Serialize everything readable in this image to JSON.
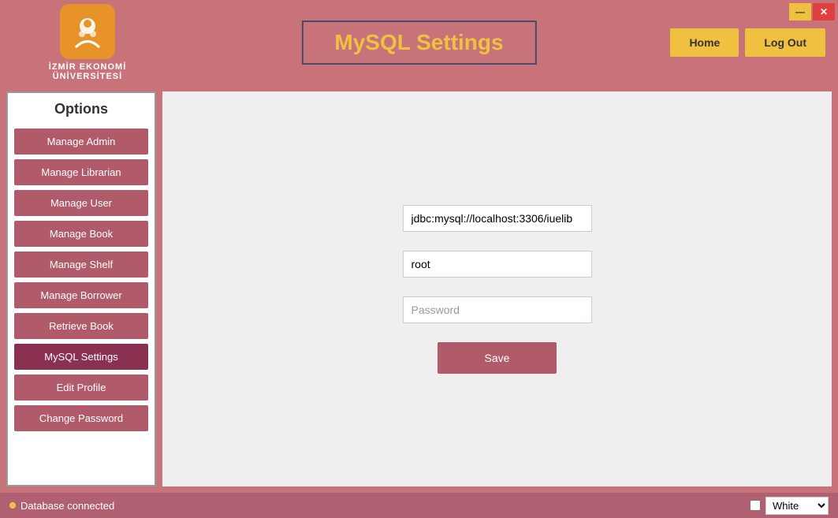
{
  "titlebar": {
    "minimize_label": "—",
    "close_label": "✕"
  },
  "header": {
    "logo_text": "İZMİR EKONOMİ ÜNİVERSİTESİ",
    "title": "MySQL Settings",
    "home_label": "Home",
    "logout_label": "Log Out"
  },
  "sidebar": {
    "title": "Options",
    "items": [
      {
        "label": "Manage Admin",
        "id": "manage-admin"
      },
      {
        "label": "Manage Librarian",
        "id": "manage-librarian"
      },
      {
        "label": "Manage User",
        "id": "manage-user"
      },
      {
        "label": "Manage Book",
        "id": "manage-book"
      },
      {
        "label": "Manage Shelf",
        "id": "manage-shelf"
      },
      {
        "label": "Manage Borrower",
        "id": "manage-borrower"
      },
      {
        "label": "Retrieve Book",
        "id": "retrieve-book"
      },
      {
        "label": "MySQL Settings",
        "id": "mysql-settings"
      },
      {
        "label": "Edit Profile",
        "id": "edit-profile"
      },
      {
        "label": "Change Password",
        "id": "change-password"
      }
    ]
  },
  "form": {
    "url_value": "jdbc:mysql://localhost:3306/iuelib",
    "username_value": "root",
    "password_placeholder": "Password",
    "save_label": "Save"
  },
  "statusbar": {
    "status_text": "Database connected",
    "theme_label": "White"
  }
}
